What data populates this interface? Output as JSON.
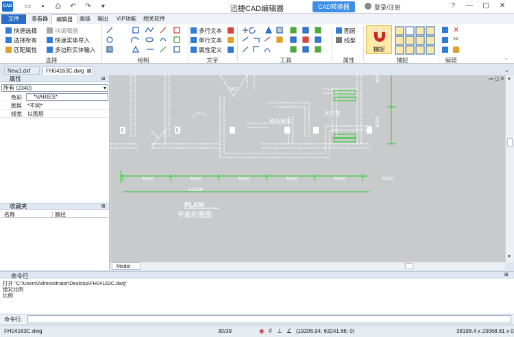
{
  "title_bar": {
    "logo": "CAD",
    "app_title": "迅捷CAD编辑器",
    "convert_button": "CAD转换器",
    "login": "登录/注册",
    "quick_access_icons": [
      "folder-icon",
      "save-icon",
      "print-icon",
      "undo-icon",
      "redo-icon"
    ]
  },
  "menu_tabs": [
    "文件",
    "查看器",
    "编辑器",
    "高级",
    "输出",
    "VIP功能",
    "相关软件"
  ],
  "ribbon": {
    "select_group": {
      "label": "选择",
      "items": [
        "快速选择",
        "选择所有",
        "匹配属性"
      ],
      "items2": [
        "块编辑器",
        "快速实体导入",
        "多边形实体输入"
      ]
    },
    "draw_group": {
      "label": "绘制"
    },
    "text_group": {
      "label": "文字",
      "items": [
        "多行文本",
        "单行文本",
        "属性定义"
      ]
    },
    "tools_group": {
      "label": "工具"
    },
    "props_group": {
      "label": "属性",
      "items": [
        "图层",
        "线型"
      ]
    },
    "snap_group": {
      "label": "捕捉",
      "snap_button": "捕捉"
    },
    "edit_group": {
      "label": "编辑"
    }
  },
  "doc_tabs": [
    "New1.dxf",
    "FH04163C.dwg"
  ],
  "properties_panel": {
    "title": "属性",
    "selector": "所有 (2340)",
    "rows": [
      {
        "key": "色彩",
        "value": "*VARIES*"
      },
      {
        "key": "图层",
        "value": "*不同*"
      },
      {
        "key": "线宽",
        "value": "以图层"
      }
    ]
  },
  "favorites_panel": {
    "title": "收藏夹",
    "columns": [
      "名称",
      "路径"
    ]
  },
  "drawing": {
    "dims_top": [
      "4500",
      "4500",
      "4500",
      "4500",
      "4500",
      "4500"
    ],
    "dim_total": "31500",
    "dim_vertical": [
      "3600",
      "4200"
    ],
    "rooms": [
      "物业用房",
      "大户室"
    ],
    "angle": "240",
    "plan_title": "PLAN:",
    "plan_subtitle": "平面布置图",
    "model_tab": "Model"
  },
  "command": {
    "title": "命令行",
    "lines": [
      "打开 \"C:\\Users\\Administrator\\Desktop\\FH04163C.dwg\"",
      "绝对比例",
      "比例"
    ],
    "prompt": "命令行:"
  },
  "status": {
    "file": "FH04163C.dwg",
    "pages": "30/39",
    "coords": "(19206.94; 63241.66; 0)",
    "size": "38198.4 x 23068.61 x 0"
  }
}
